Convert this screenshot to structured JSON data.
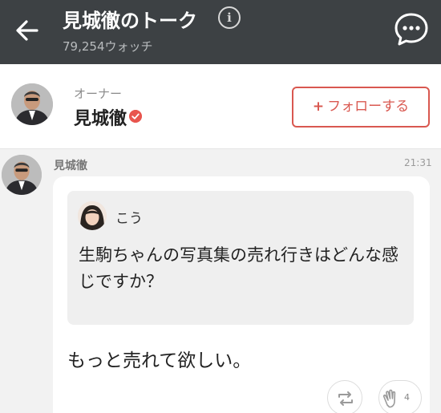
{
  "header": {
    "title": "見城徹のトーク",
    "watch_count": "79,254ウォッチ",
    "info_label": "i"
  },
  "owner": {
    "label": "オーナー",
    "name": "見城徹",
    "follow_label": "フォローする",
    "follow_plus": "+"
  },
  "message": {
    "sender": "見城徹",
    "time": "21:31",
    "quote": {
      "name": "こう",
      "text": "生駒ちゃんの写真集の売れ行きはどんな感じですか？"
    },
    "reply": "もっと売れて欲しい。",
    "clap_count": "4"
  },
  "colors": {
    "header_bg": "#3d4144",
    "accent": "#d95850",
    "verified": "#e8554e",
    "page_bg": "#f2f2f2"
  },
  "icons": [
    "back-arrow-icon",
    "info-icon",
    "chat-bubble-icon",
    "verified-check-icon",
    "repost-icon",
    "clap-icon"
  ]
}
